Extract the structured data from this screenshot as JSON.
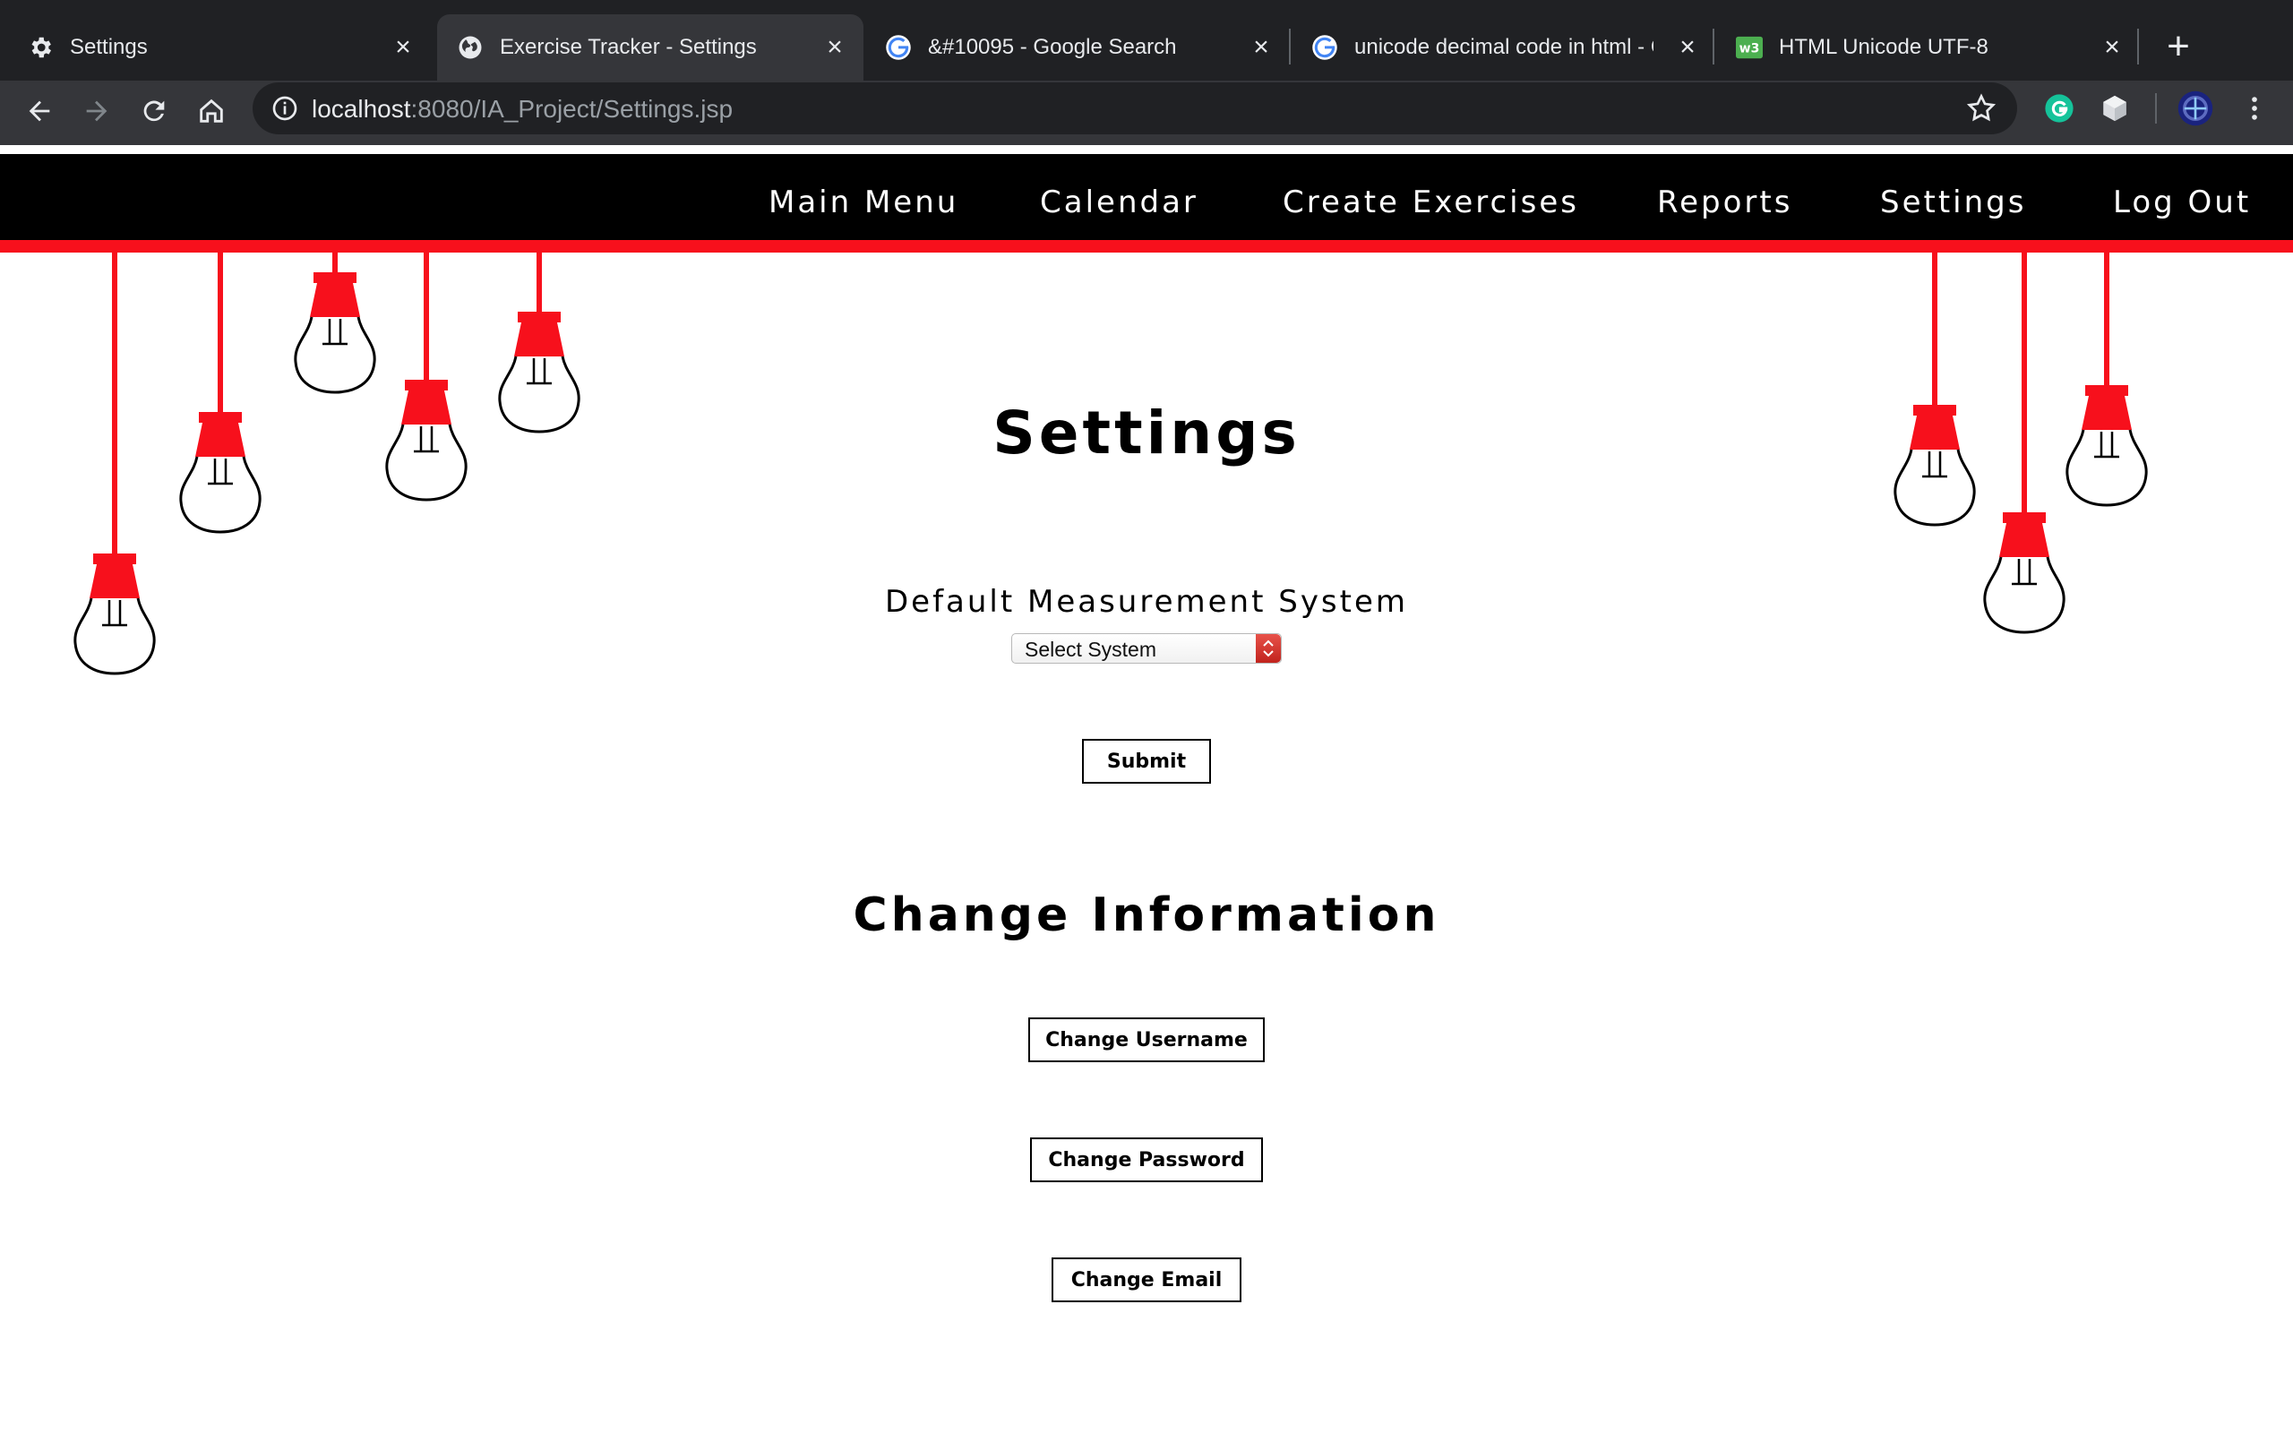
{
  "browser": {
    "tabs": [
      {
        "title": "Settings",
        "icon": "gear-icon",
        "active": false
      },
      {
        "title": "Exercise Tracker - Settings",
        "icon": "globe-icon",
        "active": true
      },
      {
        "title": "&#10095 - Google Search",
        "icon": "google-icon",
        "active": false
      },
      {
        "title": "unicode decimal code in html - Google Search",
        "icon": "google-icon",
        "active": false
      },
      {
        "title": "HTML Unicode UTF-8",
        "icon": "w3schools-icon",
        "active": false
      }
    ],
    "url_host": "localhost",
    "url_rest": ":8080/IA_Project/Settings.jsp"
  },
  "nav": {
    "items": [
      "Main Menu",
      "Calendar",
      "Create Exercises",
      "Reports",
      "Settings",
      "Log Out"
    ]
  },
  "page": {
    "title": "Settings",
    "measurement_label": "Default Measurement System",
    "select_value": "Select System",
    "submit_label": "Submit",
    "change_heading": "Change Information",
    "change_username_label": "Change Username",
    "change_password_label": "Change Password",
    "change_email_label": "Change Email"
  },
  "colors": {
    "accent": "#f7101c",
    "nav_bg": "#000000",
    "chrome_bg": "#202124"
  }
}
